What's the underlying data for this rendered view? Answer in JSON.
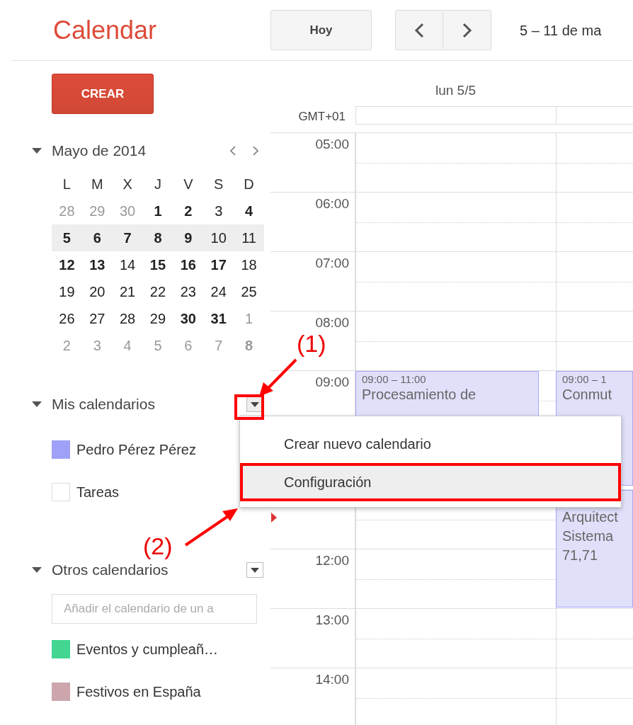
{
  "app": {
    "title": "Calendar"
  },
  "toolbar": {
    "today_button": "Hoy",
    "date_range": "5 – 11 de ma"
  },
  "create_button": "CREAR",
  "mini_calendar": {
    "title": "Mayo de 2014",
    "weekdays": [
      "L",
      "M",
      "X",
      "J",
      "V",
      "S",
      "D"
    ],
    "weeks": [
      {
        "selected": false,
        "days": [
          {
            "day": "28",
            "other_month": true,
            "has_events": false
          },
          {
            "day": "29",
            "other_month": true,
            "has_events": false
          },
          {
            "day": "30",
            "other_month": true,
            "has_events": false
          },
          {
            "day": "1",
            "other_month": false,
            "has_events": true
          },
          {
            "day": "2",
            "other_month": false,
            "has_events": true
          },
          {
            "day": "3",
            "other_month": false,
            "has_events": false
          },
          {
            "day": "4",
            "other_month": false,
            "has_events": true
          }
        ]
      },
      {
        "selected": true,
        "days": [
          {
            "day": "5",
            "other_month": false,
            "has_events": true
          },
          {
            "day": "6",
            "other_month": false,
            "has_events": true
          },
          {
            "day": "7",
            "other_month": false,
            "has_events": true
          },
          {
            "day": "8",
            "other_month": false,
            "has_events": true
          },
          {
            "day": "9",
            "other_month": false,
            "has_events": true
          },
          {
            "day": "10",
            "other_month": false,
            "has_events": false
          },
          {
            "day": "11",
            "other_month": false,
            "has_events": false
          }
        ]
      },
      {
        "selected": false,
        "days": [
          {
            "day": "12",
            "other_month": false,
            "has_events": true
          },
          {
            "day": "13",
            "other_month": false,
            "has_events": true
          },
          {
            "day": "14",
            "other_month": false,
            "has_events": false
          },
          {
            "day": "15",
            "other_month": false,
            "has_events": true
          },
          {
            "day": "16",
            "other_month": false,
            "has_events": true
          },
          {
            "day": "17",
            "other_month": false,
            "has_events": true
          },
          {
            "day": "18",
            "other_month": false,
            "has_events": false
          }
        ]
      },
      {
        "selected": false,
        "days": [
          {
            "day": "19",
            "other_month": false,
            "has_events": false
          },
          {
            "day": "20",
            "other_month": false,
            "has_events": false
          },
          {
            "day": "21",
            "other_month": false,
            "has_events": false
          },
          {
            "day": "22",
            "other_month": false,
            "has_events": false
          },
          {
            "day": "23",
            "other_month": false,
            "has_events": false
          },
          {
            "day": "24",
            "other_month": false,
            "has_events": false
          },
          {
            "day": "25",
            "other_month": false,
            "has_events": false
          }
        ]
      },
      {
        "selected": false,
        "days": [
          {
            "day": "26",
            "other_month": false,
            "has_events": false
          },
          {
            "day": "27",
            "other_month": false,
            "has_events": false
          },
          {
            "day": "28",
            "other_month": false,
            "has_events": false
          },
          {
            "day": "29",
            "other_month": false,
            "has_events": false
          },
          {
            "day": "30",
            "other_month": false,
            "has_events": true
          },
          {
            "day": "31",
            "other_month": false,
            "has_events": true
          },
          {
            "day": "1",
            "other_month": true,
            "has_events": false
          }
        ]
      },
      {
        "selected": false,
        "days": [
          {
            "day": "2",
            "other_month": true,
            "has_events": false
          },
          {
            "day": "3",
            "other_month": true,
            "has_events": false
          },
          {
            "day": "4",
            "other_month": true,
            "has_events": false
          },
          {
            "day": "5",
            "other_month": true,
            "has_events": false
          },
          {
            "day": "6",
            "other_month": true,
            "has_events": false
          },
          {
            "day": "7",
            "other_month": true,
            "has_events": false
          },
          {
            "day": "8",
            "other_month": true,
            "has_events": true
          }
        ]
      }
    ]
  },
  "my_calendars": {
    "title": "Mis calendarios",
    "items": [
      {
        "name": "Pedro Pérez Pérez",
        "color": "#9fa0f8",
        "checked": true
      },
      {
        "name": "Tareas",
        "checked": false
      }
    ]
  },
  "other_calendars": {
    "title": "Otros calendarios",
    "search": {
      "placeholder": "Añadir el calendario de un a"
    },
    "items": [
      {
        "name": "Eventos y cumpleañ…",
        "color": "#42d692",
        "checked": true
      },
      {
        "name": "Festivos en España",
        "color": "#cca6ac",
        "checked": true
      }
    ]
  },
  "day_view": {
    "timezone": "GMT+01",
    "hours_above_menu": [
      "05:00",
      "06:00",
      "07:00",
      "08:00",
      "09:00"
    ],
    "hours_below_menu": [
      "12:00",
      "13:00",
      "14:00"
    ],
    "columns": [
      {
        "header": "lun 5/5",
        "events": [
          {
            "time": "09:00 – 11:00",
            "lines": [
              "Procesamiento de"
            ]
          }
        ]
      },
      {
        "events": [
          {
            "time": "09:00 – 1",
            "lines": [
              "Conmut"
            ]
          },
          {
            "lines": [
              "Arquitect",
              "Sistema",
              "71,71"
            ]
          }
        ]
      }
    ]
  },
  "menu": {
    "items": [
      {
        "label": "Crear nuevo calendario",
        "selected": false
      },
      {
        "label": "Configuración",
        "selected": true
      }
    ]
  },
  "annotations": [
    {
      "label": "(1)"
    },
    {
      "label": "(2)"
    }
  ]
}
